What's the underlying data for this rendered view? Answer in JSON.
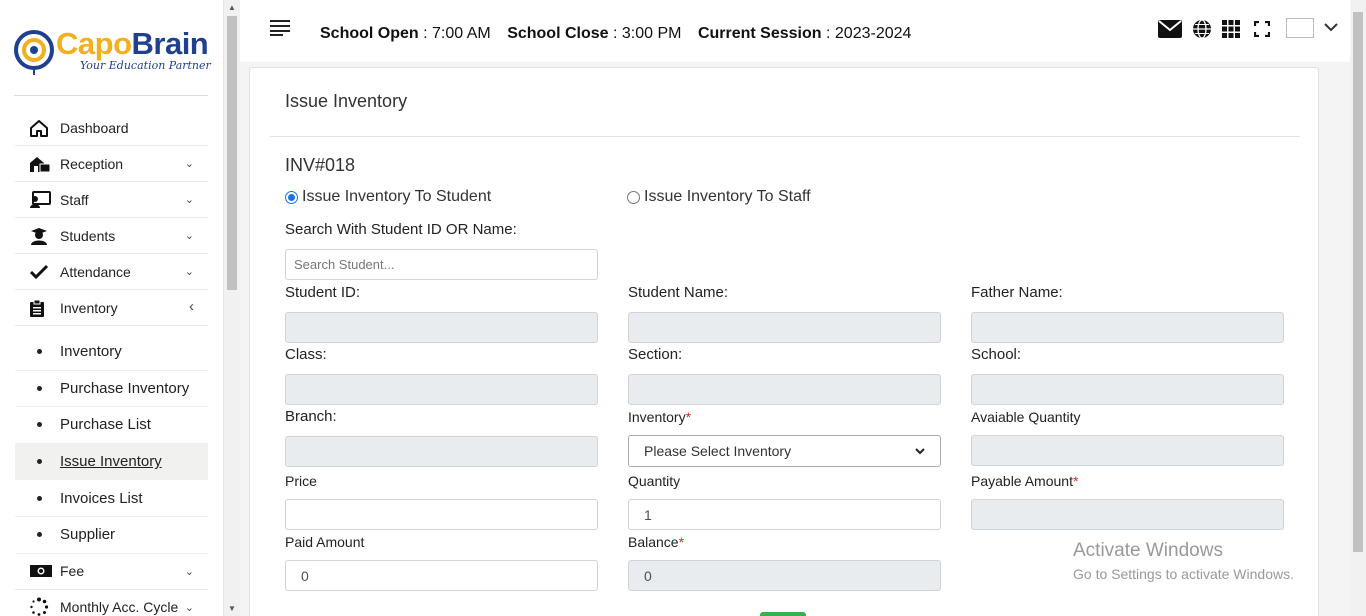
{
  "brand": {
    "name_part1": "Capo",
    "name_part2": "Brain",
    "tagline": "Your Education Partner"
  },
  "sidebar": {
    "items": [
      {
        "label": "Dashboard",
        "icon": "home-icon",
        "has_chevron": false
      },
      {
        "label": "Reception",
        "icon": "reception-icon",
        "has_chevron": true
      },
      {
        "label": "Staff",
        "icon": "staff-icon",
        "has_chevron": true
      },
      {
        "label": "Students",
        "icon": "student-icon",
        "has_chevron": true
      },
      {
        "label": "Attendance",
        "icon": "check-icon",
        "has_chevron": true
      },
      {
        "label": "Inventory",
        "icon": "clipboard-icon",
        "has_chevron": true,
        "expanded": true
      }
    ],
    "inventory_sub": [
      {
        "label": "Inventory"
      },
      {
        "label": "Purchase Inventory"
      },
      {
        "label": "Purchase List"
      },
      {
        "label": "Issue Inventory",
        "active": true
      },
      {
        "label": "Invoices List"
      },
      {
        "label": "Supplier"
      }
    ],
    "after_items": [
      {
        "label": "Fee",
        "icon": "money-icon"
      },
      {
        "label": "Monthly Acc. Cycle",
        "icon": "spinner-icon"
      }
    ]
  },
  "topbar": {
    "open_label": "School Open",
    "open_value": "7:00 AM",
    "close_label": "School Close",
    "close_value": "3:00 PM",
    "session_label": "Current Session",
    "session_value": "2023-2024",
    "colon": ":"
  },
  "page": {
    "title": "Issue Inventory",
    "invoice_no": "INV#018",
    "radio_student": "Issue Inventory To Student",
    "radio_staff": "Issue Inventory To Staff",
    "selected": "student",
    "search_label": "Search With Student ID OR Name:",
    "search_placeholder": "Search Student...",
    "labels": {
      "student_id": "Student ID:",
      "student_name": "Student Name:",
      "father_name": "Father Name:",
      "class": "Class:",
      "section": "Section:",
      "school": "School:",
      "branch": "Branch:",
      "inventory": "Inventory",
      "available_qty": "Avaiable Quantity",
      "price": "Price",
      "quantity": "Quantity",
      "payable": "Payable Amount",
      "paid": "Paid Amount",
      "balance": "Balance"
    },
    "required_mark": "*",
    "inventory_select": "Please Select Inventory",
    "quantity_value": "1",
    "paid_value": "0",
    "balance_value": "0"
  },
  "watermark": {
    "line1": "Activate Windows",
    "line2": "Go to Settings to activate Windows."
  },
  "colors": {
    "accent": "#1a73e8",
    "brand_yellow": "#f2b01e",
    "brand_blue": "#1f3f8f",
    "required": "#d9262c",
    "readonly_bg": "#e9ecef"
  }
}
